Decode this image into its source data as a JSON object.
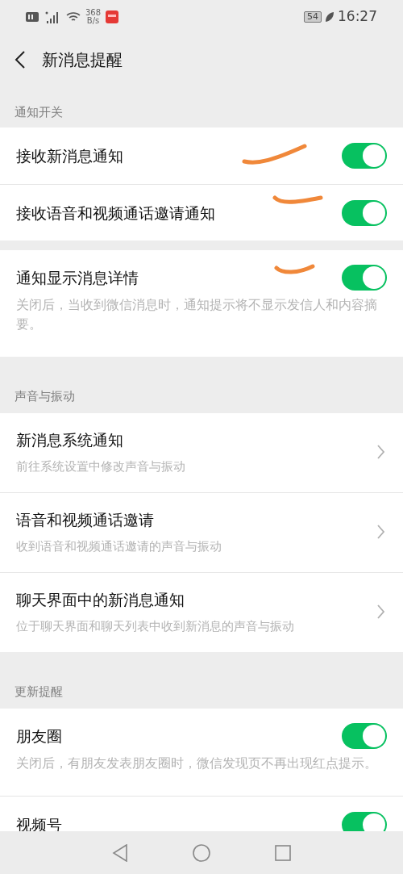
{
  "status_bar": {
    "speed_value": "368",
    "speed_unit": "B/s",
    "battery": "54",
    "time": "16:27"
  },
  "header": {
    "title": "新消息提醒"
  },
  "sections": [
    {
      "label": "通知开关",
      "groups": [
        [
          {
            "kind": "toggle",
            "title": "接收新消息通知",
            "on": true
          },
          {
            "kind": "toggle",
            "title": "接收语音和视频通话邀请通知",
            "on": true
          }
        ],
        [
          {
            "kind": "toggle",
            "title": "通知显示消息详情",
            "on": true,
            "description": "关闭后，当收到微信消息时，通知提示将不显示发信人和内容摘要。"
          }
        ]
      ]
    },
    {
      "label": "声音与振动",
      "groups": [
        [
          {
            "kind": "link",
            "title": "新消息系统通知",
            "description": "前往系统设置中修改声音与振动"
          },
          {
            "kind": "link",
            "title": "语音和视频通话邀请",
            "description": "收到语音和视频通话邀请的声音与振动"
          },
          {
            "kind": "link",
            "title": "聊天界面中的新消息通知",
            "description": "位于聊天界面和聊天列表中收到新消息的声音与振动"
          }
        ]
      ]
    },
    {
      "label": "更新提醒",
      "groups": [
        [
          {
            "kind": "toggle",
            "title": "朋友圈",
            "on": true,
            "description": "关闭后，有朋友发表朋友圈时，微信发现页不再出现红点提示。"
          },
          {
            "kind": "toggle",
            "title": "视频号",
            "on": true
          }
        ]
      ]
    }
  ]
}
